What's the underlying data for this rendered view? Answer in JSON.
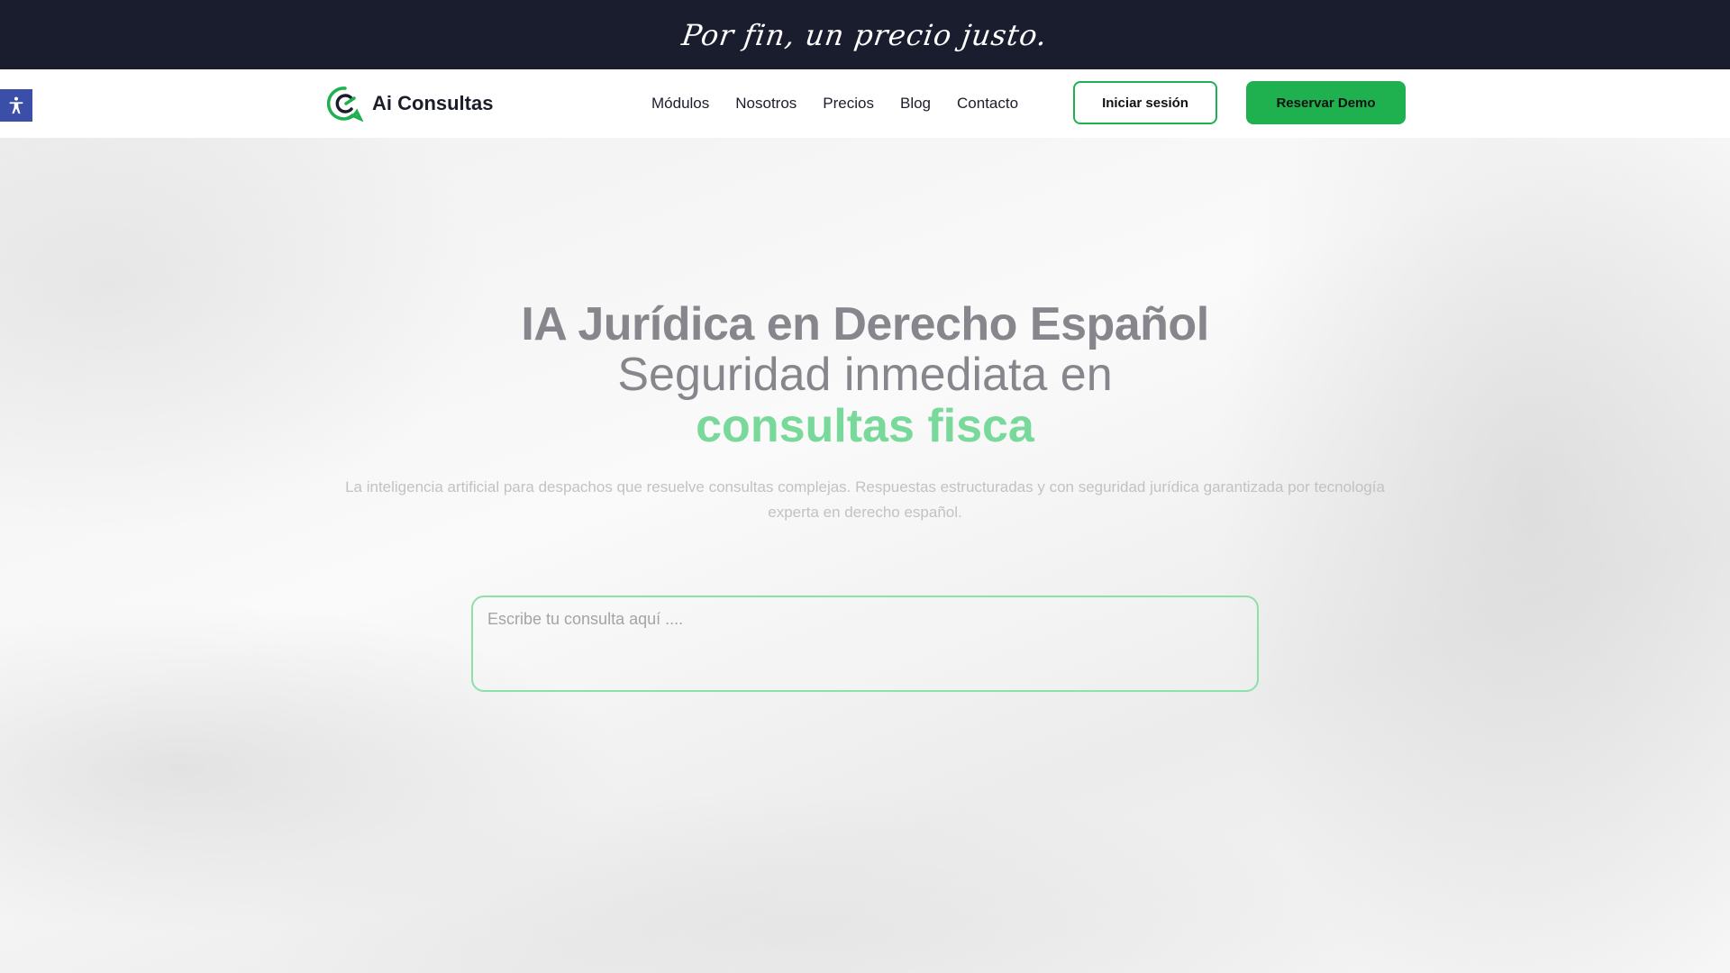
{
  "topbar": {
    "tagline": "Por fin, un precio justo."
  },
  "navbar": {
    "logo_text": "Ai Consultas",
    "links": [
      "Módulos",
      "Nosotros",
      "Precios",
      "Blog",
      "Contacto"
    ],
    "login_label": "Iniciar sesión",
    "demo_label": "Reservar Demo"
  },
  "hero": {
    "title": "IA Jurídica en Derecho Español",
    "subtitle": "Seguridad inmediata en",
    "accent": "consultas fisca",
    "description": "La inteligencia artificial para despachos que resuelve consultas complejas. Respuestas estructuradas y con seguridad jurídica garantizada por tecnología experta en derecho español.",
    "query_placeholder": "Escribe tu consulta aquí ...."
  },
  "colors": {
    "topbar_bg": "#1a1d2e",
    "brand_green": "#1fb14f",
    "accent_green": "#79d99a",
    "a11y_blue": "#3b4ea8"
  }
}
